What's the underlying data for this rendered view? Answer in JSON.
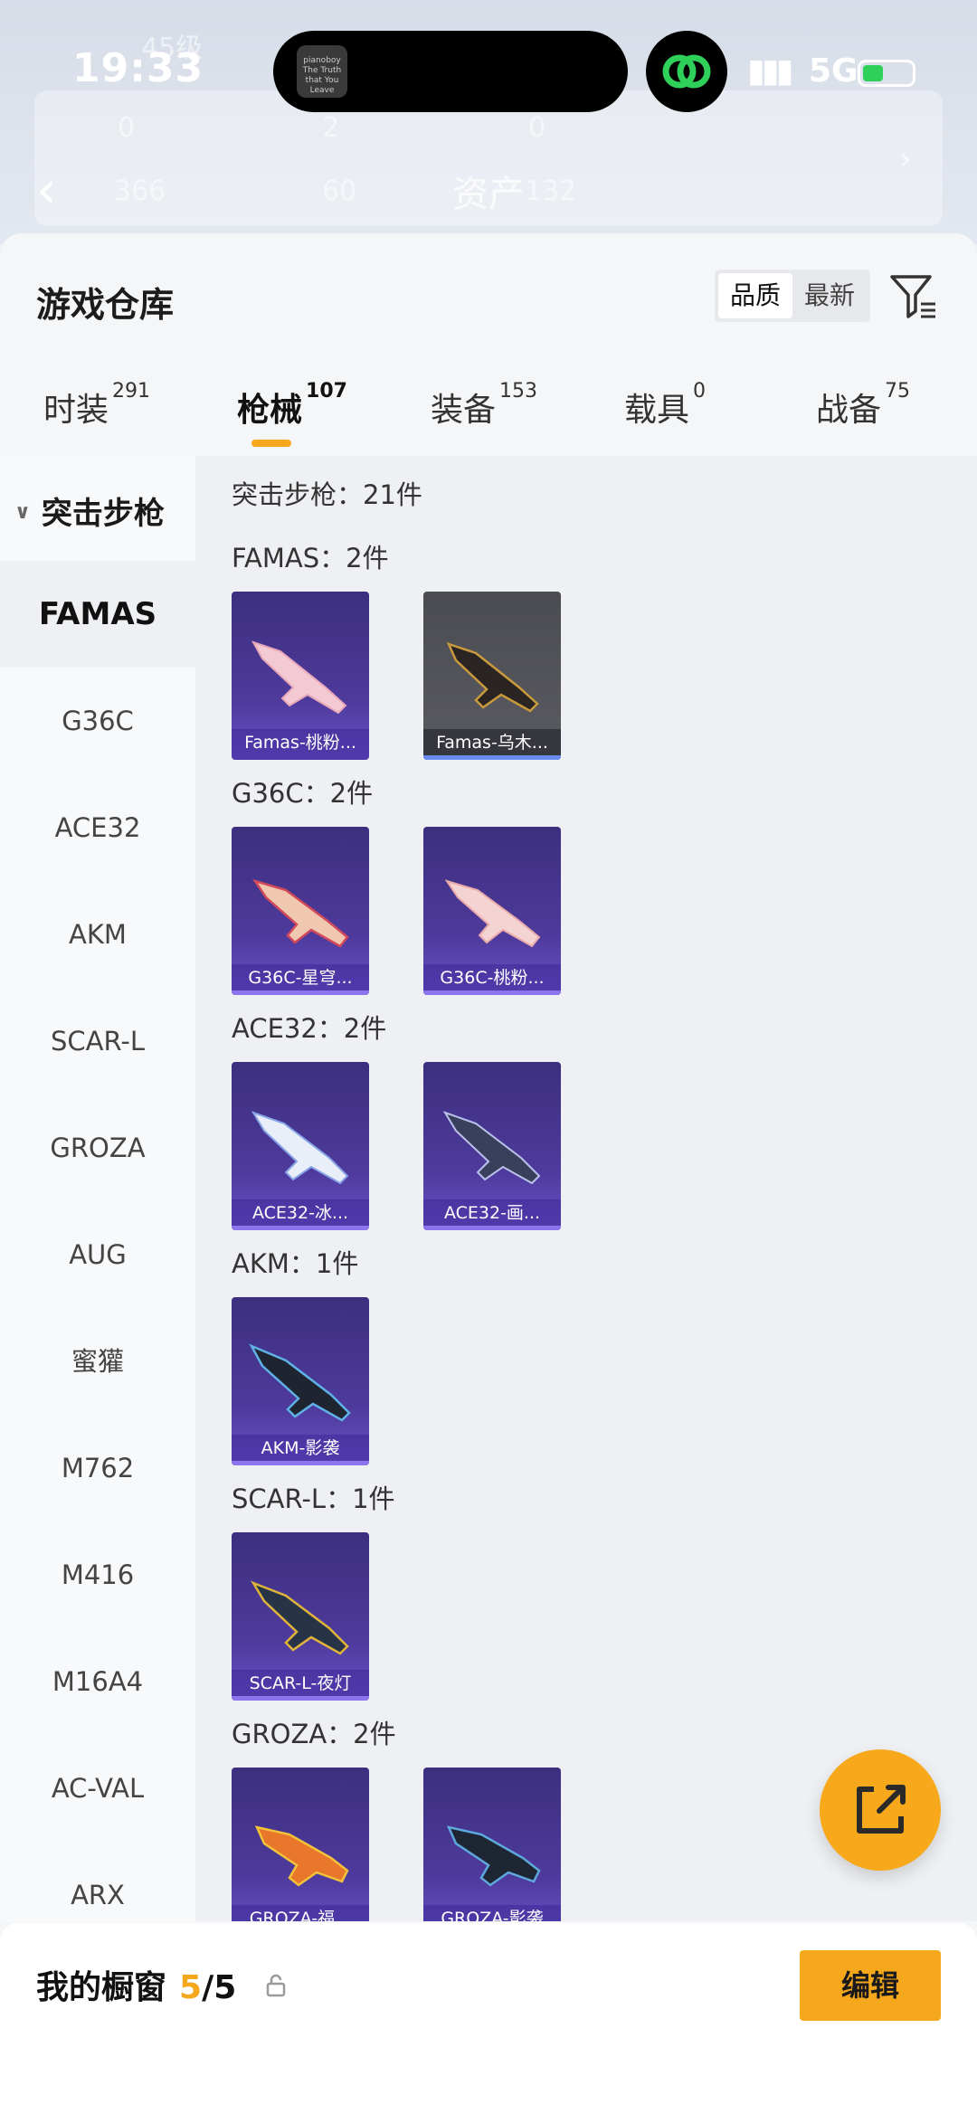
{
  "status_bar": {
    "time": "19:33",
    "network": "5G"
  },
  "background": {
    "level_ghost": "45级",
    "counts": [
      "0",
      "2",
      "0"
    ],
    "counts2": [
      "366",
      "60",
      "132"
    ],
    "assets_label": "资产"
  },
  "island": {
    "thumb_text": "pianoboy\nThe Truth that You Leave"
  },
  "sheet": {
    "title": "游戏仓库",
    "sort_options": [
      "品质",
      "最新"
    ],
    "tabs": [
      {
        "label": "时装",
        "count": "291"
      },
      {
        "label": "枪械",
        "count": "107"
      },
      {
        "label": "装备",
        "count": "153"
      },
      {
        "label": "载具",
        "count": "0"
      },
      {
        "label": "战备",
        "count": "75"
      }
    ],
    "active_tab": "枪械"
  },
  "sidebar": {
    "category": "突击步枪",
    "items": [
      "FAMAS",
      "G36C",
      "ACE32",
      "AKM",
      "SCAR-L",
      "GROZA",
      "AUG",
      "蜜獾",
      "M762",
      "M416",
      "M16A4",
      "AC-VAL",
      "ARX"
    ],
    "active": "FAMAS"
  },
  "content": {
    "summary": "突击步枪：21件",
    "groups": [
      {
        "title": "FAMAS：2件",
        "items": [
          "Famas-桃粉...",
          "Famas-乌木..."
        ]
      },
      {
        "title": "G36C：2件",
        "items": [
          "G36C-星穹...",
          "G36C-桃粉..."
        ]
      },
      {
        "title": "ACE32：2件",
        "items": [
          "ACE32-冰...",
          "ACE32-画..."
        ]
      },
      {
        "title": "AKM：1件",
        "items": [
          "AKM-影袭"
        ]
      },
      {
        "title": "SCAR-L：1件",
        "items": [
          "SCAR-L-夜灯"
        ]
      },
      {
        "title": "GROZA：2件",
        "items": [
          "GROZA-福...",
          "GROZA-影袭"
        ]
      }
    ]
  },
  "showcase": {
    "title": "我的橱窗",
    "count": "5",
    "total": "/5",
    "edit_label": "编辑"
  },
  "colors": {
    "accent": "#f6a81c",
    "tile_purple": "#4e3a9c",
    "battery_green": "#2fd05a"
  }
}
